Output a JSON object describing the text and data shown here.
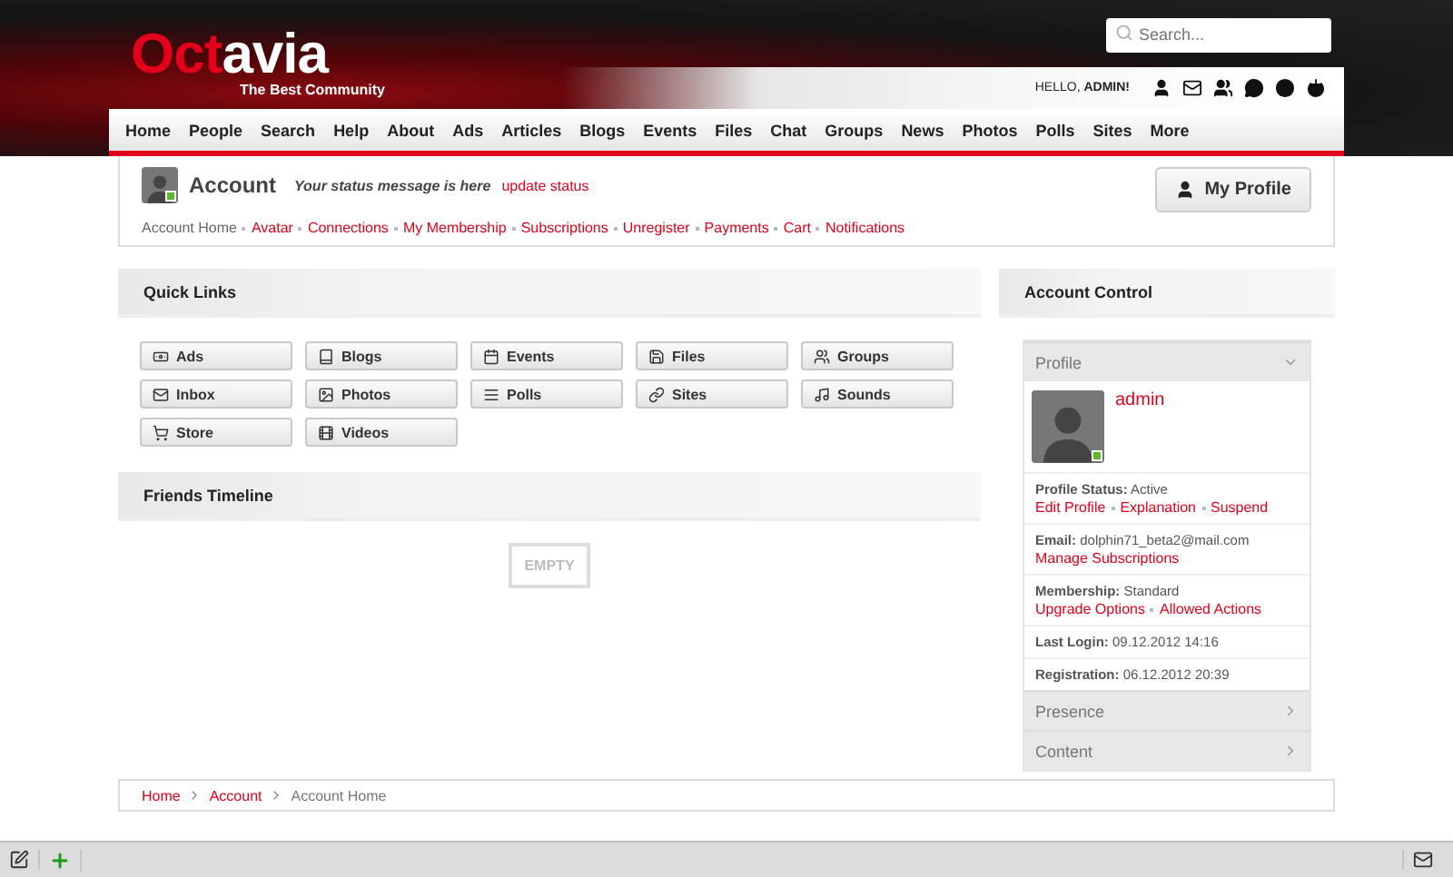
{
  "header": {
    "logo": {
      "part_1": "Oct",
      "part_2": "avia",
      "tagline": "The Best Community"
    },
    "search": {
      "placeholder": "Search..."
    },
    "greeting": {
      "text": "HELLO, ",
      "user": "ADMIN!"
    }
  },
  "nav": [
    {
      "label": "Home",
      "selected": false
    },
    {
      "label": "People",
      "selected": false
    },
    {
      "label": "Search",
      "selected": false
    },
    {
      "label": "Help",
      "selected": false
    },
    {
      "label": "About",
      "selected": false
    },
    {
      "label": "Ads",
      "selected": false
    },
    {
      "label": "Articles",
      "selected": false
    },
    {
      "label": "Blogs",
      "selected": false
    },
    {
      "label": "Events",
      "selected": false
    },
    {
      "label": "Files",
      "selected": false
    },
    {
      "label": "Chat",
      "selected": false
    },
    {
      "label": "Groups",
      "selected": false
    },
    {
      "label": "News",
      "selected": false
    },
    {
      "label": "Photos",
      "selected": false
    },
    {
      "label": "Polls",
      "selected": false
    },
    {
      "label": "Sites",
      "selected": false
    },
    {
      "label": "More",
      "selected": false
    }
  ],
  "account": {
    "title": "Account",
    "status_message": "Your status message is here",
    "update_link": "update status",
    "online": true,
    "button": "My Profile",
    "menu": [
      {
        "label": "Account Home",
        "selected": true
      },
      {
        "label": "Avatar",
        "selected": false
      },
      {
        "label": "Connections",
        "selected": false
      },
      {
        "label": "My Membership",
        "selected": false
      },
      {
        "label": "Subscriptions",
        "selected": false
      },
      {
        "label": "Unregister",
        "selected": false
      },
      {
        "label": "Payments",
        "selected": false
      },
      {
        "label": "Cart",
        "selected": false
      },
      {
        "label": "Notifications",
        "selected": false
      }
    ]
  },
  "quick_links": {
    "title": "Quick Links",
    "items": [
      "Ads",
      "Blogs",
      "Events",
      "Files",
      "Groups",
      "Inbox",
      "Photos",
      "Polls",
      "Sites",
      "Sounds",
      "Store",
      "Videos"
    ]
  },
  "friends_timeline": {
    "title": "Friends Timeline",
    "empty": "EMPTY"
  },
  "account_control": {
    "title": "Account Control",
    "sections": [
      {
        "title": "Profile",
        "expanded": true,
        "user": "admin",
        "online": true,
        "rows": [
          {
            "text": "**Profile Status:** Active",
            "links": [
              "Edit Profile",
              "Explanation",
              "Suspend"
            ]
          },
          {
            "text": "**Email:** dolphin71_beta2@mail.com",
            "links": [
              "Manage Subscriptions"
            ]
          },
          {
            "text": "**Membership:** Standard",
            "links": [
              "Upgrade Options",
              "Allowed Actions"
            ]
          },
          {
            "text": "**Last Login:** 09.12.2012 14:16",
            "links": []
          },
          {
            "text": "**Registration:** 06.12.2012 20:39",
            "links": []
          }
        ]
      },
      {
        "title": "Presence",
        "expanded": false
      },
      {
        "title": "Content",
        "expanded": false
      }
    ]
  },
  "breadcrumb": [
    {
      "label": "Home",
      "selected": false
    },
    {
      "label": "Account",
      "selected": false
    },
    {
      "label": "Account Home",
      "selected": true
    }
  ]
}
